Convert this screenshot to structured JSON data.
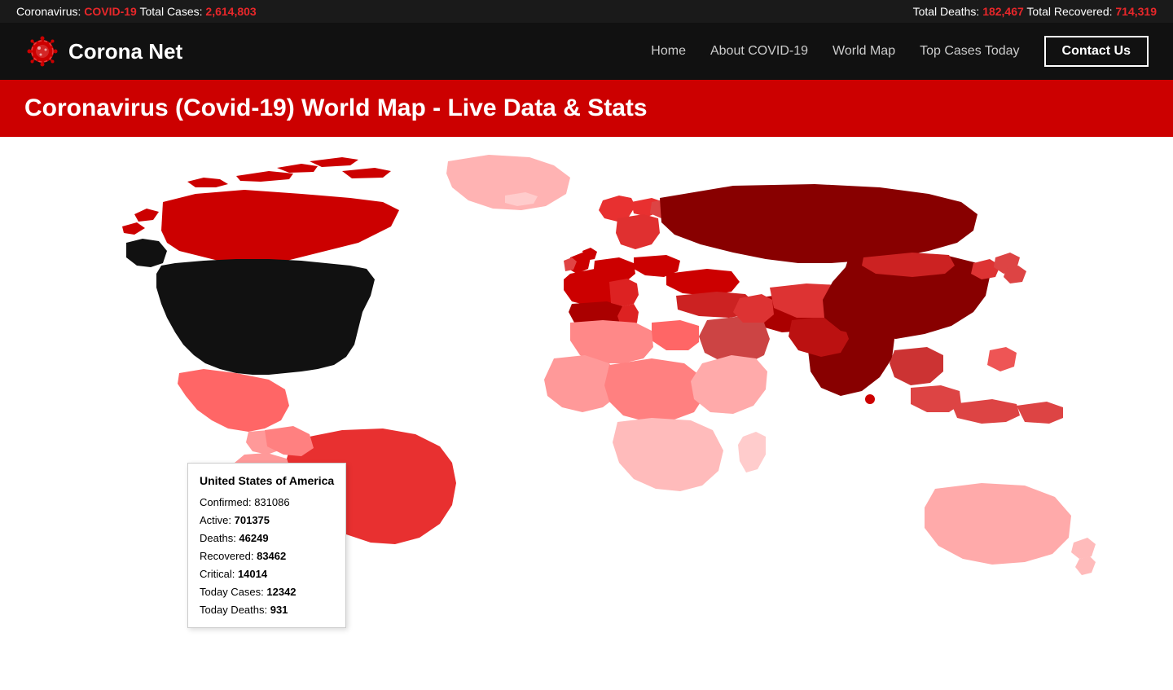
{
  "ticker": {
    "left": "Coronavirus: ",
    "covid_label": "COVID-19",
    "total_cases_label": " Total Cases: ",
    "total_cases_value": "2,614,803",
    "deaths_label": "Total Deaths: ",
    "deaths_value": "182,467",
    "recovered_label": " Total Recovered: ",
    "recovered_value": "714,319"
  },
  "navbar": {
    "logo_text": "Corona Net",
    "links": [
      "Home",
      "About COVID-19",
      "World Map",
      "Top Cases Today"
    ],
    "contact_label": "Contact Us"
  },
  "banner": {
    "title": "Coronavirus (Covid-19) World Map - Live Data & Stats"
  },
  "tooltip": {
    "country": "United States of America",
    "confirmed_label": "Confirmed: ",
    "confirmed_value": "831086",
    "active_label": "Active: ",
    "active_value": "701375",
    "deaths_label": "Deaths: ",
    "deaths_value": "46249",
    "recovered_label": "Recovered: ",
    "recovered_value": "83462",
    "critical_label": "Critical: ",
    "critical_value": "14014",
    "today_cases_label": "Today Cases: ",
    "today_cases_value": "12342",
    "today_deaths_label": "Today Deaths: ",
    "today_deaths_value": "931"
  }
}
